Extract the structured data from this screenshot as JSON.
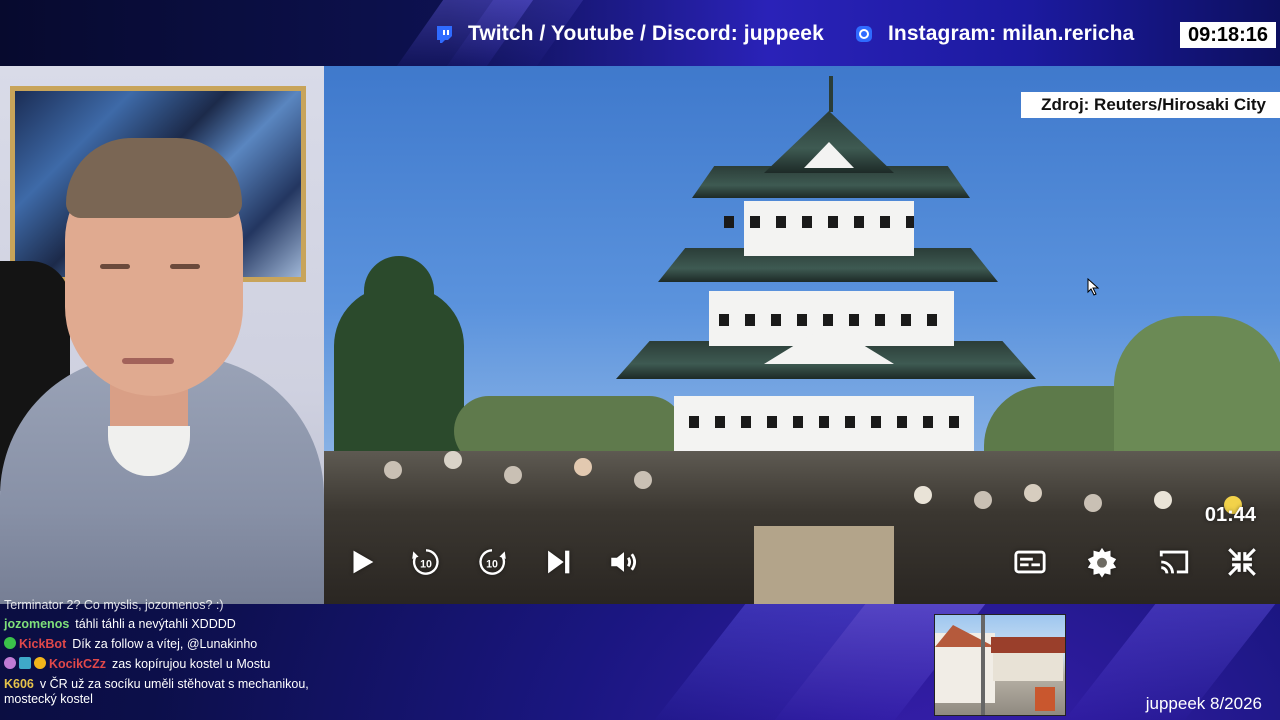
{
  "header": {
    "socials": [
      {
        "label": "Twitch / Youtube / Discord: juppeek",
        "icon": "twitch-icon"
      },
      {
        "label": "Instagram: milan.rericha",
        "icon": "instagram-icon"
      }
    ],
    "clock": "09:18:16"
  },
  "video": {
    "source_label": "Zdroj: Reuters/Hirosaki City",
    "timecode": "01:44",
    "controls": [
      "play-icon",
      "rewind-10-icon",
      "forward-10-icon",
      "next-icon",
      "volume-icon",
      "subtitles-icon",
      "settings-icon",
      "cast-icon",
      "exit-fullscreen-icon"
    ],
    "rewind_seconds": "10",
    "forward_seconds": "10"
  },
  "chat": {
    "partial_line": "Terminator 2? Co myslis, jozomenos? :)",
    "messages": [
      {
        "user": "jozomenos",
        "text": "táhli táhli a nevýtahli XDDDD",
        "color": "#7fe07a"
      },
      {
        "user": "KickBot",
        "text": "Dík za follow a vítej, @Lunakinho",
        "color": "#e0484a"
      },
      {
        "user": "KocikCZz",
        "text": "zas kopírujou kostel u Mostu",
        "color": "#e0484a"
      },
      {
        "user": "K606",
        "text": "v ČR už za socíku uměli stěhovat s mechanikou,",
        "color": "#e6c34a"
      }
    ],
    "continuation": "mostecký kostel"
  },
  "footer": {
    "channel_tag": "juppeek 8/2026"
  },
  "colors": {
    "accent": "#2a22b8",
    "background": "#0a0d3a"
  }
}
